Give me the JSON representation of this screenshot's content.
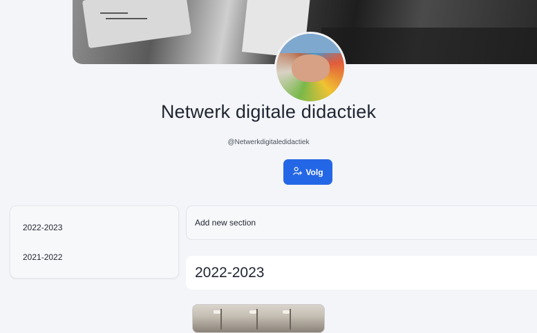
{
  "profile": {
    "name": "Netwerk digitale didactiek",
    "handle": "@Netwerkdigitaledidactiek",
    "follow_label": "Volg",
    "follow_icon": "person-plus-icon",
    "accent_color": "#2467e6"
  },
  "sidebar": {
    "items": [
      {
        "label": "2022-2023"
      },
      {
        "label": "2021-2022"
      }
    ]
  },
  "main": {
    "add_section_label": "Add new section",
    "section_title": "2022-2023"
  }
}
